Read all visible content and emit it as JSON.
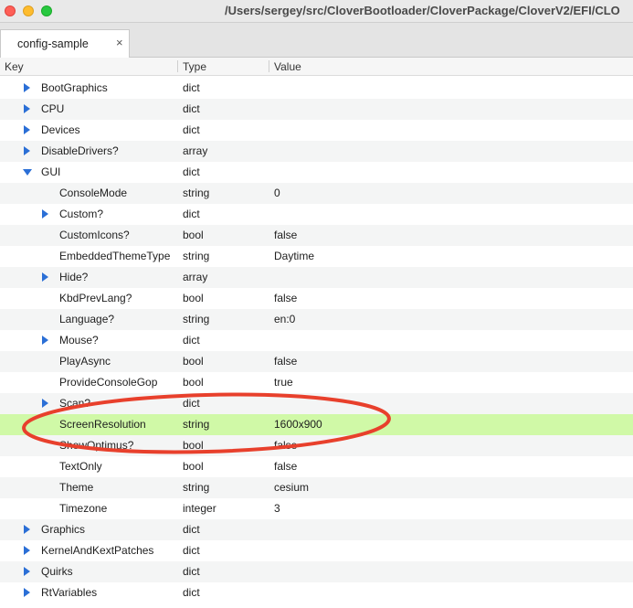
{
  "window": {
    "title": "/Users/sergey/src/CloverBootloader/CloverPackage/CloverV2/EFI/CLO"
  },
  "tab": {
    "label": "config-sample",
    "close": "×"
  },
  "columns": {
    "key": "Key",
    "type": "Type",
    "value": "Value"
  },
  "annotation": {
    "color": "#e8402c"
  },
  "rows": [
    {
      "key": "BootGraphics",
      "type": "dict",
      "value": ""
    },
    {
      "key": "CPU",
      "type": "dict",
      "value": ""
    },
    {
      "key": "Devices",
      "type": "dict",
      "value": ""
    },
    {
      "key": "DisableDrivers?",
      "type": "array",
      "value": ""
    },
    {
      "key": "GUI",
      "type": "dict",
      "value": ""
    },
    {
      "key": "ConsoleMode",
      "type": "string",
      "value": "0"
    },
    {
      "key": "Custom?",
      "type": "dict",
      "value": ""
    },
    {
      "key": "CustomIcons?",
      "type": "bool",
      "value": "false"
    },
    {
      "key": "EmbeddedThemeType",
      "type": "string",
      "value": "Daytime"
    },
    {
      "key": "Hide?",
      "type": "array",
      "value": ""
    },
    {
      "key": "KbdPrevLang?",
      "type": "bool",
      "value": "false"
    },
    {
      "key": "Language?",
      "type": "string",
      "value": "en:0"
    },
    {
      "key": "Mouse?",
      "type": "dict",
      "value": ""
    },
    {
      "key": "PlayAsync",
      "type": "bool",
      "value": "false"
    },
    {
      "key": "ProvideConsoleGop",
      "type": "bool",
      "value": "true"
    },
    {
      "key": "Scan?",
      "type": "dict",
      "value": ""
    },
    {
      "key": "ScreenResolution",
      "type": "string",
      "value": "1600x900"
    },
    {
      "key": "ShowOptimus?",
      "type": "bool",
      "value": "false"
    },
    {
      "key": "TextOnly",
      "type": "bool",
      "value": "false"
    },
    {
      "key": "Theme",
      "type": "string",
      "value": "cesium"
    },
    {
      "key": "Timezone",
      "type": "integer",
      "value": "3"
    },
    {
      "key": "Graphics",
      "type": "dict",
      "value": ""
    },
    {
      "key": "KernelAndKextPatches",
      "type": "dict",
      "value": ""
    },
    {
      "key": "Quirks",
      "type": "dict",
      "value": ""
    },
    {
      "key": "RtVariables",
      "type": "dict",
      "value": ""
    }
  ]
}
